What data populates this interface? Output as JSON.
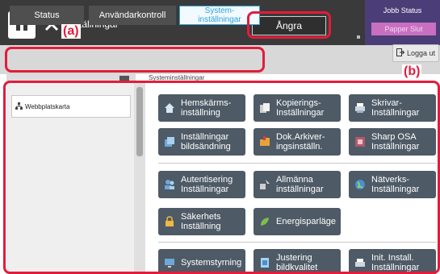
{
  "topbar": {
    "title": "Inställningar",
    "undo_label": "Ångra",
    "job_status_label": "Jobb Status",
    "job_status_sub": "Papper Slut",
    "home_icon": "home-icon",
    "tools_icon": "tools-icon"
  },
  "tabs": [
    {
      "label": "Status"
    },
    {
      "label": "Användarkontroll"
    },
    {
      "label": "System-\ninställningar"
    }
  ],
  "logout": {
    "label": "Logga ut"
  },
  "left_panel": {
    "item": "Webbplatskarta"
  },
  "main_header": "Systeminställningar",
  "buttons": [
    {
      "label": "Hemskärms-\ninställning",
      "icon": "home-icon"
    },
    {
      "label": "Kopierings-\nInställningar",
      "icon": "copy-icon"
    },
    {
      "label": "Skrivar-\nInställningar",
      "icon": "printer-icon"
    },
    {
      "label": "Inställningar\nbildsändning",
      "icon": "image-send-icon"
    },
    {
      "label": "Dok.Arkiver-\ningsinställn.",
      "icon": "folder-icon"
    },
    {
      "label": "Sharp OSA\nInställningar",
      "icon": "osa-icon"
    },
    {
      "label": "Autentisering\nInställningar",
      "icon": "users-icon"
    },
    {
      "label": "Allmänna\ninställningar",
      "icon": "general-icon"
    },
    {
      "label": "Nätverks-\nInställningar",
      "icon": "globe-icon"
    },
    {
      "label": "Säkerhets\nInställning",
      "icon": "lock-icon"
    },
    {
      "label": "Energisparläge",
      "icon": "leaf-icon"
    },
    {
      "label": "Systemstyrning",
      "icon": "monitor-icon"
    },
    {
      "label": "Justering\nbildkvalitet",
      "icon": "adjust-icon"
    },
    {
      "label": "Init. Install.\nInställningar",
      "icon": "init-icon"
    }
  ],
  "annotations": [
    {
      "label": "(a)"
    },
    {
      "label": "(b)"
    }
  ],
  "colors": {
    "topbar": "#3a3a3a",
    "button": "#4e5a66",
    "accent": "#2aa6d8",
    "annotation": "#e21c3b",
    "job_status": "#4a3d78"
  }
}
